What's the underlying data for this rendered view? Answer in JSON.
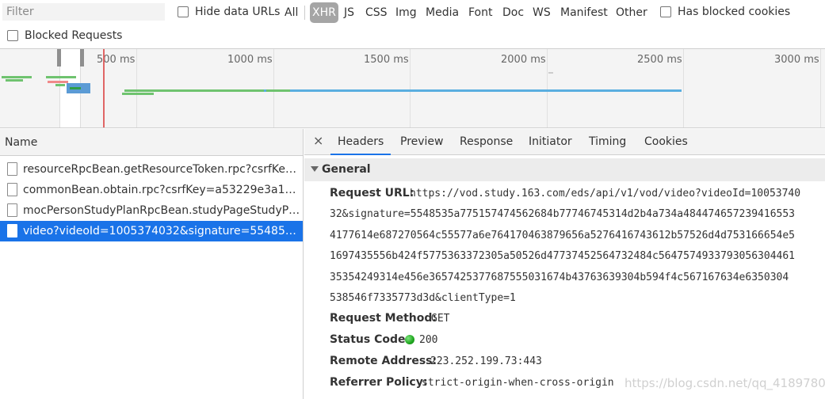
{
  "toolbar": {
    "filter_placeholder": "Filter",
    "hide_data_urls": "Hide data URLs",
    "type_filters": [
      {
        "label": "All",
        "active": false
      },
      {
        "label": "XHR",
        "active": true
      },
      {
        "label": "JS",
        "active": false
      },
      {
        "label": "CSS",
        "active": false
      },
      {
        "label": "Img",
        "active": false
      },
      {
        "label": "Media",
        "active": false
      },
      {
        "label": "Font",
        "active": false
      },
      {
        "label": "Doc",
        "active": false
      },
      {
        "label": "WS",
        "active": false
      },
      {
        "label": "Manifest",
        "active": false
      },
      {
        "label": "Other",
        "active": false
      }
    ],
    "has_blocked_cookies": "Has blocked cookies",
    "blocked_requests": "Blocked Requests"
  },
  "overview": {
    "ticks": [
      "500 ms",
      "1000 ms",
      "1500 ms",
      "2000 ms",
      "2500 ms",
      "3000 ms"
    ]
  },
  "requests": {
    "header": "Name",
    "rows": [
      {
        "name": "resourceRpcBean.getResourceToken.rpc?csrfKey=a...",
        "selected": false
      },
      {
        "name": "commonBean.obtain.rpc?csrfKey=a53229e3a1b24...",
        "selected": false
      },
      {
        "name": "mocPersonStudyPlanRpcBean.studyPageStudyPlan....",
        "selected": false
      },
      {
        "name": "video?videoId=1005374032&signature=5548535a...",
        "selected": true
      }
    ]
  },
  "details": {
    "close": "×",
    "tabs": [
      "Headers",
      "Preview",
      "Response",
      "Initiator",
      "Timing",
      "Cookies"
    ],
    "active_tab": "Headers",
    "section": "General",
    "request_url_label": "Request URL:",
    "request_url_lines": [
      "https://vod.study.163.com/eds/api/v1/vod/video?videoId=10053740",
      "32&signature=5548535a775157474562684b77746745314d2b4a734a484474657239416553",
      "4177614e687270564c55577a6e764170463879656a5276416743612b57526d4d753166654e5",
      "1697435556b424f5775363372305a50526d47737452564732484c5647574933793056304461",
      "35354249314e456e3657425377687555031674b43763639304b594f4c567167634e6350304",
      "538546f7335773d3d&clientType=1"
    ],
    "request_method_label": "Request Method:",
    "request_method": "GET",
    "status_code_label": "Status Code:",
    "status_code": "200",
    "status_color": "#1ea51e",
    "remote_address_label": "Remote Address:",
    "remote_address": "223.252.199.73:443",
    "referrer_policy_label": "Referrer Policy:",
    "referrer_policy": "strict-origin-when-cross-origin"
  },
  "watermark": "https://blog.csdn.net/qq_41897800"
}
